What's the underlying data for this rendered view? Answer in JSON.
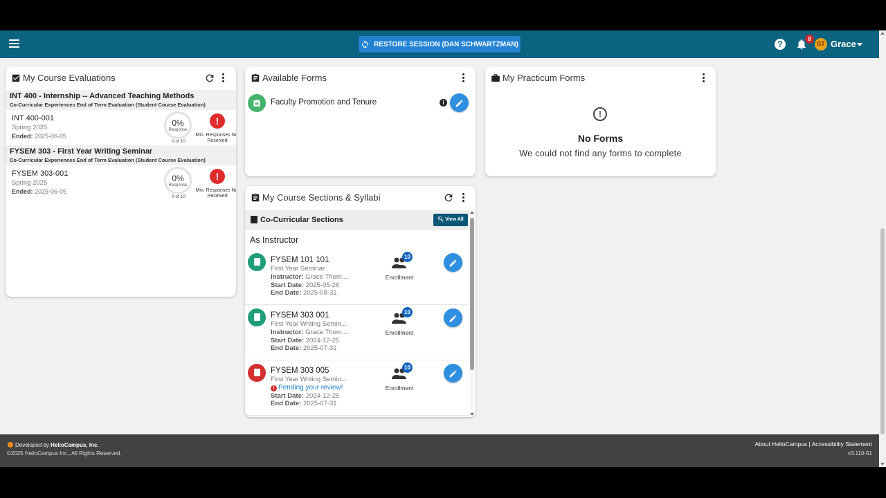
{
  "topbar": {
    "restore_label": "RESTORE SESSION (DAN SCHWARTZMAN)",
    "notification_count": "8",
    "user_initials": "GT",
    "user_name": "Grace",
    "help_glyph": "?",
    "colors": {
      "bar": "#0b6380",
      "restore_button": "#2383d2",
      "badge": "#c62828",
      "avatar": "#e6a118"
    }
  },
  "course_evaluations": {
    "title": "My Course Evaluations",
    "groups": [
      {
        "title": "INT 400 - Internship -- Advanced Teaching Methods",
        "subtitle": "Co-Curricular Experiences End of Term Evaluation (Student Course Evaluation)",
        "code": "INT 400-001",
        "term": "Spring 2025",
        "ended_label": "Ended:",
        "ended": "2025-06-05",
        "percent": "0%",
        "response_label": "Response",
        "count": "0 of 10",
        "status": "Min. Responses Not Received"
      },
      {
        "title": "FYSEM 303 - First Year Writing Seminar",
        "subtitle": "Co-Curricular Experiences End of Term Evaluation (Student Course Evaluation)",
        "code": "FYSEM 303-001",
        "term": "Spring 2025",
        "ended_label": "Ended:",
        "ended": "2025-06-05",
        "percent": "0%",
        "response_label": "Response",
        "count": "0 of 10",
        "status": "Min. Responses Not Received"
      }
    ]
  },
  "available_forms": {
    "title": "Available Forms",
    "items": [
      {
        "name": "Faculty Promotion and Tenure",
        "icon": "form-icon"
      }
    ]
  },
  "practicum_forms": {
    "title": "My Practicum Forms",
    "empty_title": "No Forms",
    "empty_text": "We could not find any forms to complete"
  },
  "sections": {
    "title": "My Course Sections & Syllabi",
    "group_label": "Co-Curricular Sections",
    "view_all": "View All",
    "role_label": "As Instructor",
    "enrollment_label": "Enrollment",
    "instructor_label": "Instructor:",
    "start_label": "Start Date:",
    "end_label": "End Date:",
    "items": [
      {
        "code": "FYSEM 101 101",
        "name": "First Year Seminar",
        "instructor": "Grace Thom...",
        "start": "2025-05-26",
        "end": "2025-08-31",
        "enrollment": "10",
        "status_color": "#1f9e78"
      },
      {
        "code": "FYSEM 303 001",
        "name": "First Year Writing Semin...",
        "instructor": "Grace Thom...",
        "start": "2024-12-25",
        "end": "2025-07-31",
        "enrollment": "10",
        "status_color": "#1f9e78"
      },
      {
        "code": "FYSEM 303 005",
        "name": "First Year Writing Semin...",
        "pending": "Pending your review!",
        "start": "2024-12-25",
        "end": "2025-07-31",
        "enrollment": "10",
        "status_color": "#d32f2f"
      }
    ]
  },
  "footer": {
    "developed_by": "Developed by",
    "company": "HelioCampus, Inc.",
    "copyright": "©2025 HelioCampus Inc., All Rights Reserved.",
    "about_link": "About HelioCampus",
    "separator": "|",
    "accessibility_link": "Accessibility Statement",
    "version": "v3.110-51"
  }
}
